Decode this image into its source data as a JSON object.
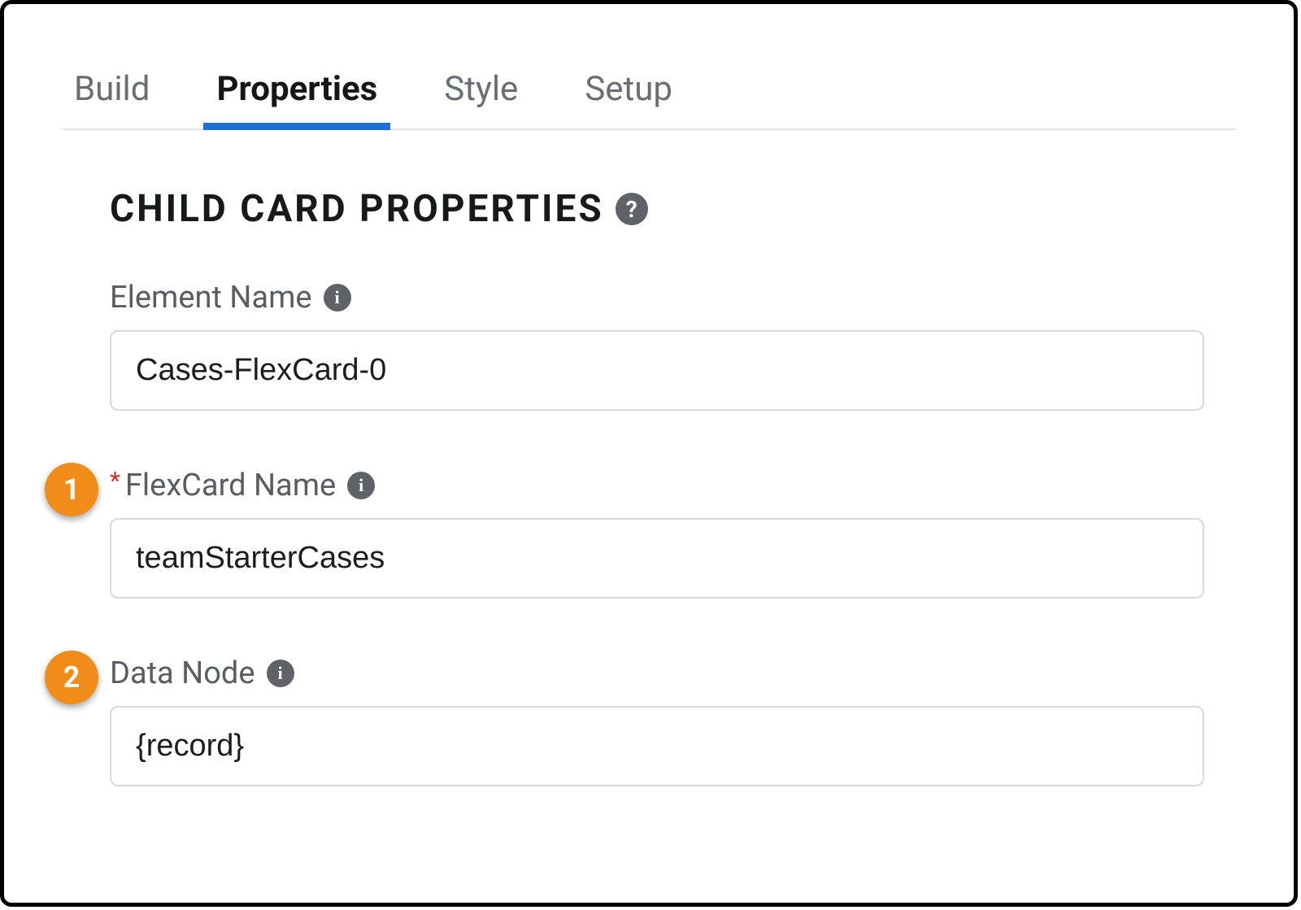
{
  "tabs": {
    "build": "Build",
    "properties": "Properties",
    "style": "Style",
    "setup": "Setup"
  },
  "section": {
    "title": "CHILD CARD PROPERTIES"
  },
  "fields": {
    "elementName": {
      "label": "Element Name",
      "value": "Cases-FlexCard-0"
    },
    "flexcardName": {
      "label": "FlexCard Name",
      "value": "teamStarterCases",
      "required": "*"
    },
    "dataNode": {
      "label": "Data Node",
      "value": "{record}"
    }
  },
  "callouts": {
    "one": "1",
    "two": "2"
  }
}
